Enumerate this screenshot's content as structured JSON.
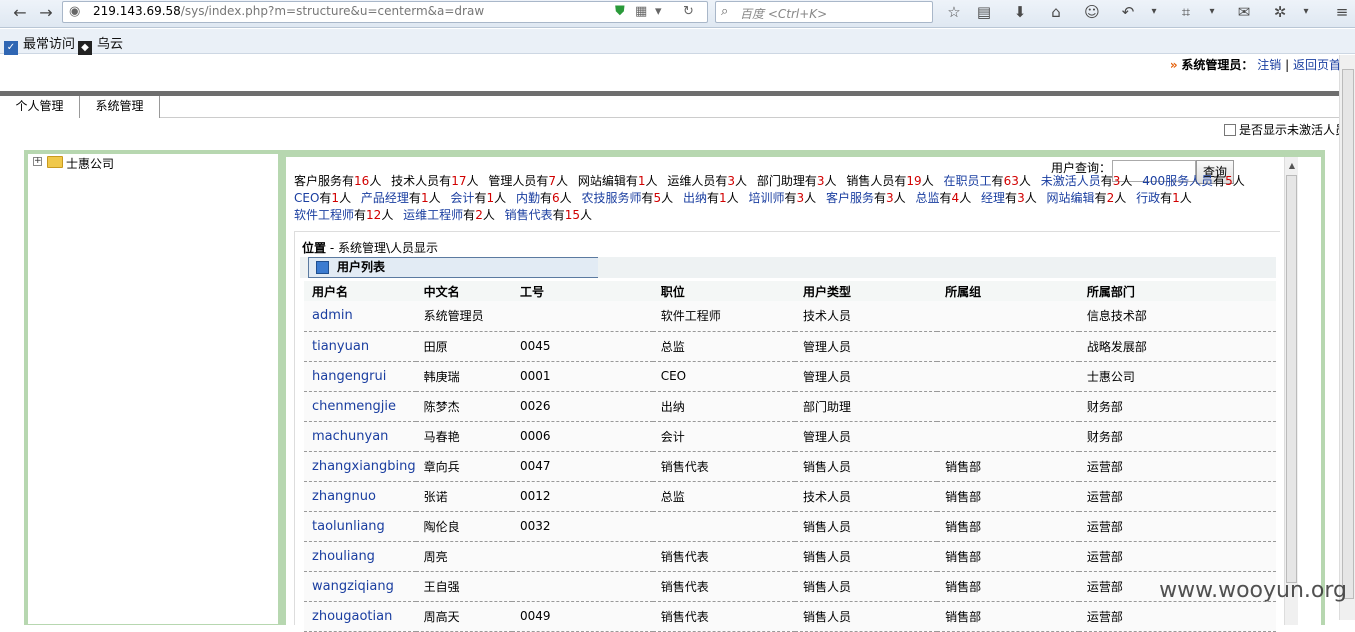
{
  "browser": {
    "url_host": "219.143.69.58",
    "url_path": "/sys/index.php?m=structure&u=centerm&a=draw",
    "search_placeholder": "百度 <Ctrl+K>",
    "bookmarks": [
      "最常访问",
      "乌云"
    ]
  },
  "header": {
    "arrow": "»",
    "admin_label": "系统管理员：",
    "logout": "注销",
    "separator": "|",
    "back": "返回页首"
  },
  "tabs": [
    "个人管理",
    "系统管理"
  ],
  "show_inactive_label": "是否显示未激活人员",
  "tree": {
    "root": "士惠公司"
  },
  "query": {
    "label": "用户查询：",
    "button": "查询"
  },
  "stats": [
    {
      "label": "客户服务",
      "count": "16",
      "blue": false
    },
    {
      "label": "技术人员",
      "count": "17",
      "blue": false
    },
    {
      "label": "管理人员",
      "count": "7",
      "blue": false
    },
    {
      "label": "网站编辑",
      "count": "1",
      "blue": false
    },
    {
      "label": "运维人员",
      "count": "3",
      "blue": false
    },
    {
      "label": "部门助理",
      "count": "3",
      "blue": false
    },
    {
      "label": "销售人员",
      "count": "19",
      "blue": false
    },
    {
      "label": "在职员工",
      "count": "63",
      "blue": true
    },
    {
      "label": "未激活人员",
      "count": "3",
      "blue": true
    },
    {
      "label": "400服务人员",
      "count": "5",
      "blue": true
    },
    {
      "label": "CEO",
      "count": "1",
      "blue": true
    },
    {
      "label": "产品经理",
      "count": "1",
      "blue": true
    },
    {
      "label": "会计",
      "count": "1",
      "blue": true
    },
    {
      "label": "内勤",
      "count": "6",
      "blue": true
    },
    {
      "label": "农技服务师",
      "count": "5",
      "blue": true
    },
    {
      "label": "出纳",
      "count": "1",
      "blue": true
    },
    {
      "label": "培训师",
      "count": "3",
      "blue": true
    },
    {
      "label": "客户服务",
      "count": "3",
      "blue": true
    },
    {
      "label": "总监",
      "count": "4",
      "blue": true
    },
    {
      "label": "经理",
      "count": "3",
      "blue": true
    },
    {
      "label": "网站编辑",
      "count": "2",
      "blue": true
    },
    {
      "label": "行政",
      "count": "1",
      "blue": true
    },
    {
      "label": "软件工程师",
      "count": "12",
      "blue": true
    },
    {
      "label": "运维工程师",
      "count": "2",
      "blue": true
    },
    {
      "label": "销售代表",
      "count": "15",
      "blue": true
    }
  ],
  "stat_has": "有",
  "stat_unit": "人",
  "location": {
    "label": "位置",
    "path": " - 系统管理\\人员显示"
  },
  "list_title": "用户列表",
  "columns": [
    "用户名",
    "中文名",
    "工号",
    "职位",
    "用户类型",
    "所属组",
    "所属部门"
  ],
  "rows": [
    [
      "admin",
      "系统管理员",
      "",
      "软件工程师",
      "技术人员",
      "",
      "信息技术部"
    ],
    [
      "tianyuan",
      "田原",
      "0045",
      "总监",
      "管理人员",
      "",
      "战略发展部"
    ],
    [
      "hangengrui",
      "韩庚瑞",
      "0001",
      "CEO",
      "管理人员",
      "",
      "士惠公司"
    ],
    [
      "chenmengjie",
      "陈梦杰",
      "0026",
      "出纳",
      "部门助理",
      "",
      "财务部"
    ],
    [
      "machunyan",
      "马春艳",
      "0006",
      "会计",
      "管理人员",
      "",
      "财务部"
    ],
    [
      "zhangxiangbing",
      "章向兵",
      "0047",
      "销售代表",
      "销售人员",
      "销售部",
      "运营部"
    ],
    [
      "zhangnuo",
      "张诺",
      "0012",
      "总监",
      "技术人员",
      "销售部",
      "运营部"
    ],
    [
      "taolunliang",
      "陶伦良",
      "0032",
      "",
      "销售人员",
      "销售部",
      "运营部"
    ],
    [
      "zhouliang",
      "周亮",
      "",
      "销售代表",
      "销售人员",
      "销售部",
      "运营部"
    ],
    [
      "wangziqiang",
      "王自强",
      "",
      "销售代表",
      "销售人员",
      "销售部",
      "运营部"
    ],
    [
      "zhougaotian",
      "周高天",
      "0049",
      "销售代表",
      "销售人员",
      "销售部",
      "运营部"
    ]
  ],
  "watermark": "www.wooyun.org"
}
